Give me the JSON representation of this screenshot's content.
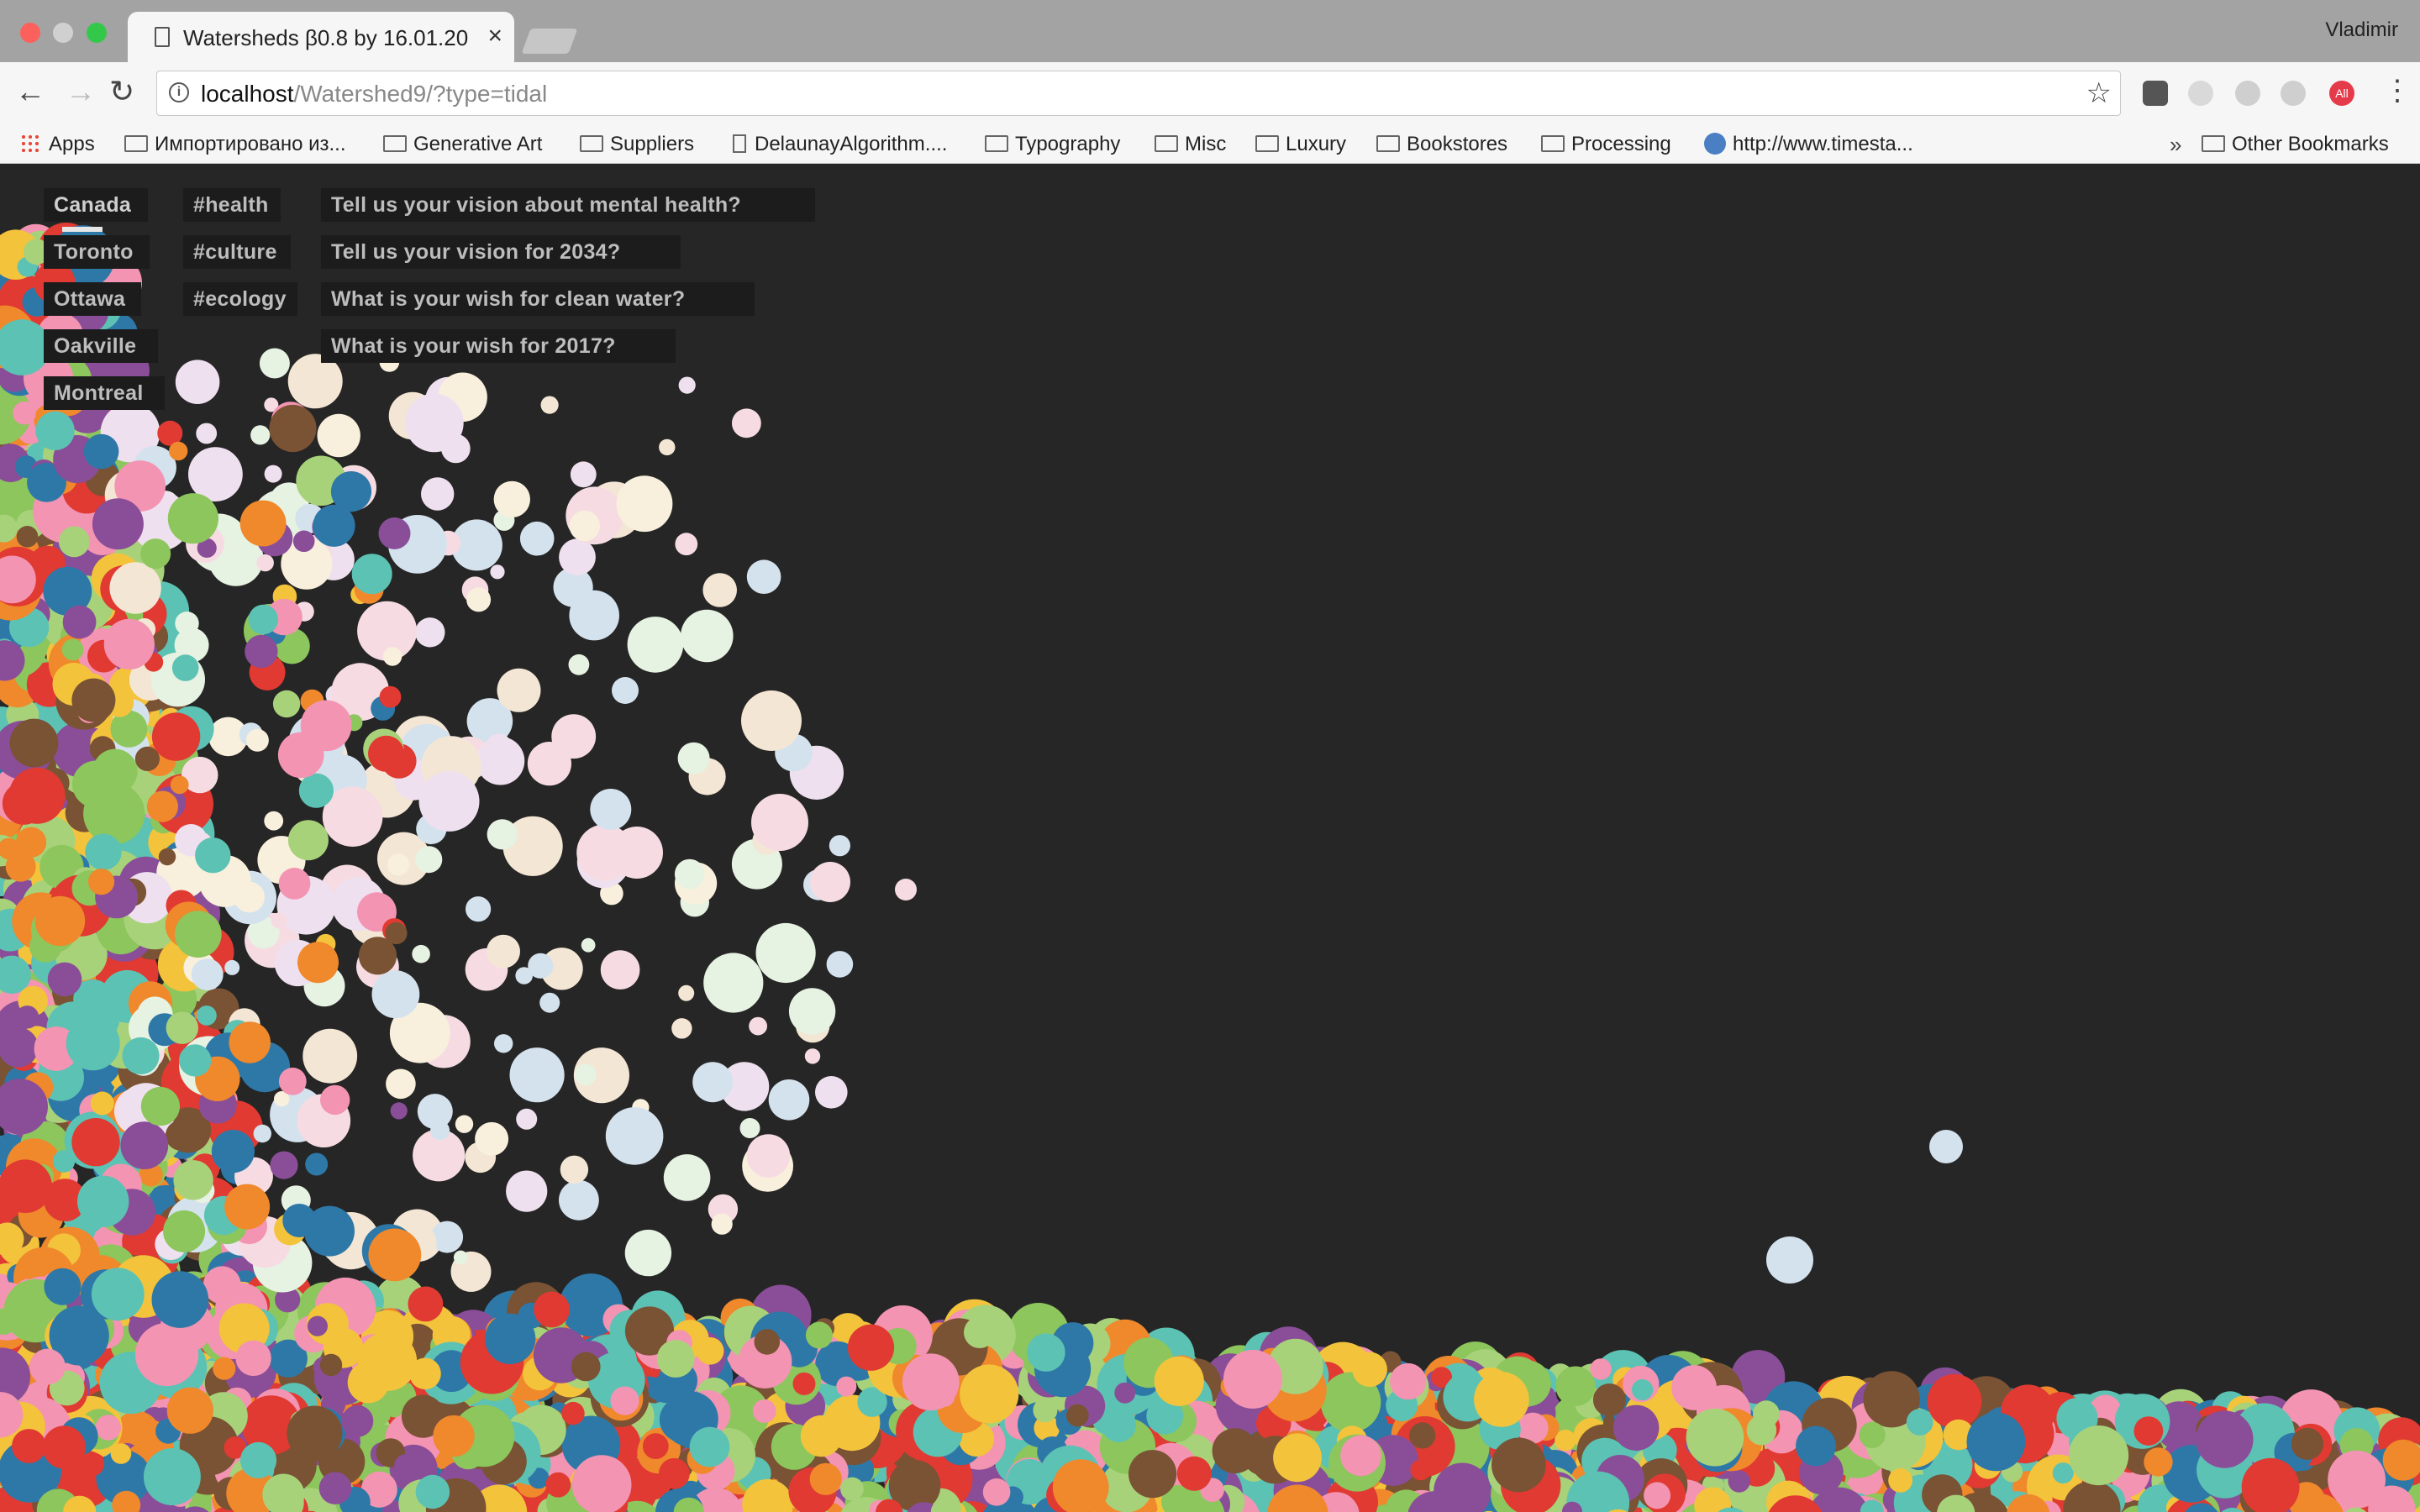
{
  "browser": {
    "tab_title": "Watersheds β0.8 by 16.01.20",
    "tab_close": "×",
    "profile_name": "Vladimir",
    "url_host": "localhost",
    "url_path": "/Watershed9/?type=tidal",
    "ext_red_label": "All",
    "bookmarks_chevron": "»",
    "bookmarks": [
      {
        "label": "Apps",
        "icon": "apps-grid-icon"
      },
      {
        "label": "Импортировано из...",
        "icon": "folder-icon"
      },
      {
        "label": "Generative Art",
        "icon": "folder-icon"
      },
      {
        "label": "Suppliers",
        "icon": "folder-icon"
      },
      {
        "label": "DelaunayAlgorithm....",
        "icon": "page-icon"
      },
      {
        "label": "Typography",
        "icon": "folder-icon"
      },
      {
        "label": "Misc",
        "icon": "folder-icon"
      },
      {
        "label": "Luxury",
        "icon": "folder-icon"
      },
      {
        "label": "Bookstores",
        "icon": "folder-icon"
      },
      {
        "label": "Processing",
        "icon": "folder-icon"
      },
      {
        "label": "http://www.timesta...",
        "icon": "globe-icon"
      },
      {
        "label": "Other Bookmarks",
        "icon": "folder-icon"
      }
    ]
  },
  "app": {
    "cities": [
      "Canada",
      "Toronto",
      "Ottawa",
      "Oakville",
      "Montreal"
    ],
    "tags": [
      "#health",
      "#culture",
      "#ecology"
    ],
    "questions": [
      "Tell us your vision about mental health?",
      "Tell us your vision for 2034?",
      "What is your wish for clean water?",
      "What is your wish for 2017?"
    ],
    "selected_city": "Canada",
    "bubble_colors": [
      "#e03a32",
      "#f0882c",
      "#f3c33c",
      "#8cc65c",
      "#5cc2b4",
      "#2e78a8",
      "#8a4e98",
      "#f394b2",
      "#7a5234",
      "#a8d27a"
    ],
    "bubble_pale_colors": [
      "#f4e6d4",
      "#e6f2e2",
      "#d4e2ee",
      "#f6dce2",
      "#efe0ef",
      "#f8f0dc"
    ]
  }
}
